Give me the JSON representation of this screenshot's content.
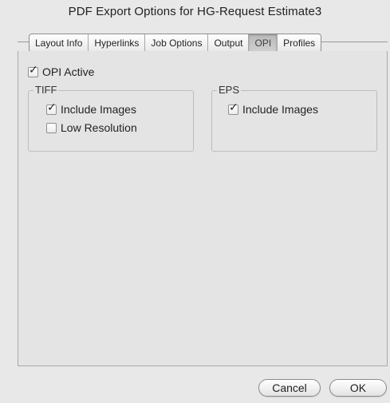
{
  "window": {
    "title": "PDF Export Options for HG-Request Estimate3"
  },
  "tabs": [
    {
      "label": "Layout Info",
      "active": false
    },
    {
      "label": "Hyperlinks",
      "active": false
    },
    {
      "label": "Job Options",
      "active": false
    },
    {
      "label": "Output",
      "active": false
    },
    {
      "label": "OPI",
      "active": true
    },
    {
      "label": "Profiles",
      "active": false
    }
  ],
  "opi": {
    "active_label": "OPI Active",
    "active_checked": true,
    "tiff": {
      "label": "TIFF",
      "include_images_label": "Include Images",
      "include_images_checked": true,
      "low_resolution_label": "Low Resolution",
      "low_resolution_checked": false
    },
    "eps": {
      "label": "EPS",
      "include_images_label": "Include Images",
      "include_images_checked": true
    }
  },
  "buttons": {
    "cancel": "Cancel",
    "ok": "OK"
  },
  "icons": {
    "checkmark": "✓"
  }
}
